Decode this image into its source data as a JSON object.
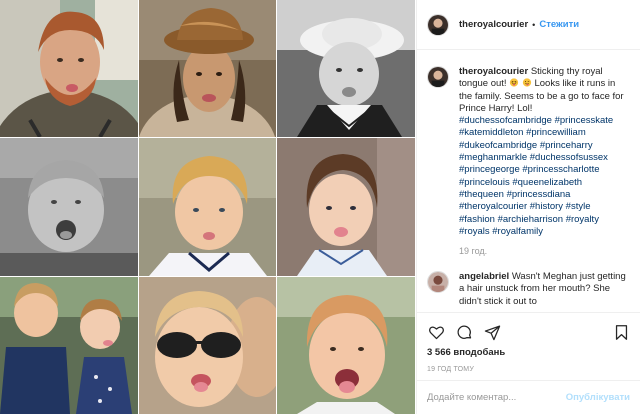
{
  "header": {
    "username": "theroyalcourier",
    "separator": "•",
    "follow_label": "Стежити"
  },
  "caption": {
    "username": "theroyalcourier",
    "text_before_emoji": "Sticking thy royal tongue out!",
    "text_after_emoji": "Looks like it runs in the family. Seems to be a go to face for Prince Harry! Lol!",
    "emoji_icons": [
      "squinting-tongue-emoji",
      "winking-tongue-emoji"
    ],
    "hashtags": [
      "#duchessofcambridge",
      "#princesskate",
      "#katemiddleton",
      "#princewilliam",
      "#dukeofcambridge",
      "#princeharry",
      "#meghanmarkle",
      "#duchessofsussex",
      "#princegeorge",
      "#princesscharlotte",
      "#princelouis",
      "#queenelizabeth",
      "#thequeen",
      "#princessdiana",
      "#theroyalcourier",
      "#history",
      "#style",
      "#fashion",
      "#archieharrison",
      "#royalty",
      "#royals",
      "#royalfamily"
    ],
    "time_ago": "19 год."
  },
  "comment": {
    "username": "angelabriel",
    "text": "Wasn't Meghan just getting a hair unstuck from her mouth? She didn't stick it out to"
  },
  "actions": {
    "icons": [
      "heart-icon",
      "comment-icon",
      "share-icon",
      "bookmark-icon"
    ],
    "likes": "3 566 вподобань",
    "date": "19 ГОД ТОМУ"
  },
  "add_comment": {
    "placeholder": "Додайте коментар...",
    "publish_label": "Опублікувати"
  },
  "colors": {
    "link": "#003569",
    "follow": "#3897f0",
    "muted": "#999999",
    "publish_disabled": "#b2dffc"
  }
}
